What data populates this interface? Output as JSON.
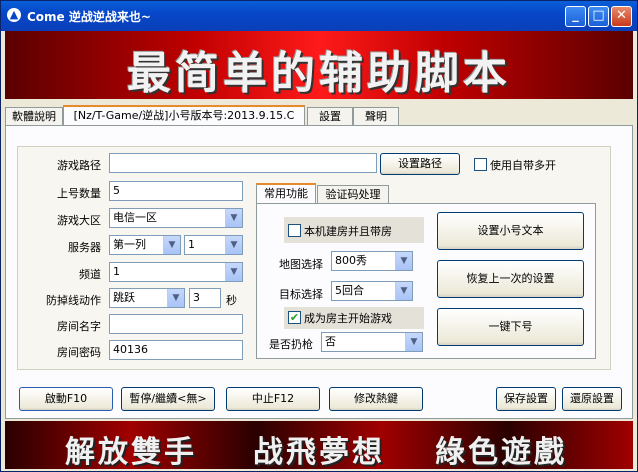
{
  "window": {
    "title": "Come 逆战逆战来也~",
    "banner": "最简单的辅助脚本",
    "controls": {
      "minimize": "_",
      "maximize": "□",
      "close": "✕"
    }
  },
  "tabs": [
    {
      "label": "軟體說明"
    },
    {
      "label": "[Nz/T-Game/逆战]小号版本号:2013.9.15.C"
    },
    {
      "label": "設置"
    },
    {
      "label": "聲明"
    }
  ],
  "form": {
    "game_path_label": "游戏路径",
    "game_path_value": "",
    "set_path_btn": "设置路径",
    "use_multi_label": "使用自带多开",
    "account_count_label": "上号数量",
    "account_count_value": "5",
    "region_label": "游戏大区",
    "region_value": "电信一区",
    "server_label": "服务器",
    "server_value1": "第一列",
    "server_value2": "1",
    "channel_label": "频道",
    "channel_value": "1",
    "disconnect_label": "防掉线动作",
    "disconnect_value": "跳跃",
    "disconnect_seconds": "3",
    "seconds_unit": "秒",
    "room_name_label": "房间名字",
    "room_name_value": "",
    "room_pwd_label": "房间密码",
    "room_pwd_value": "40136"
  },
  "inner_tabs": [
    {
      "label": "常用功能"
    },
    {
      "label": "验证码处理"
    }
  ],
  "inner": {
    "host_room_label": "本机建房并且带房",
    "map_label": "地图选择",
    "map_value": "800秀",
    "target_label": "目标选择",
    "target_value": "5回合",
    "start_as_host_label": "成为房主开始游戏",
    "throw_label": "是否扔枪",
    "throw_value": "否"
  },
  "side_buttons": {
    "set_text": "设置小号文本",
    "restore_last": "恢复上一次的设置",
    "one_click_logout": "一键下号"
  },
  "bottom_buttons": {
    "start": "啟動F10",
    "pause": "暫停/繼續<無>",
    "stop": "中止F12",
    "hotkey": "修改熱鍵",
    "save": "保存設置",
    "restore": "還原設置"
  },
  "bottom_banner": [
    "解放雙手",
    "战飛夢想",
    "綠色遊戲"
  ],
  "colors": {
    "title_bar": "#0647c9",
    "banner_red": "#c00000",
    "check_green": "#21a121"
  }
}
